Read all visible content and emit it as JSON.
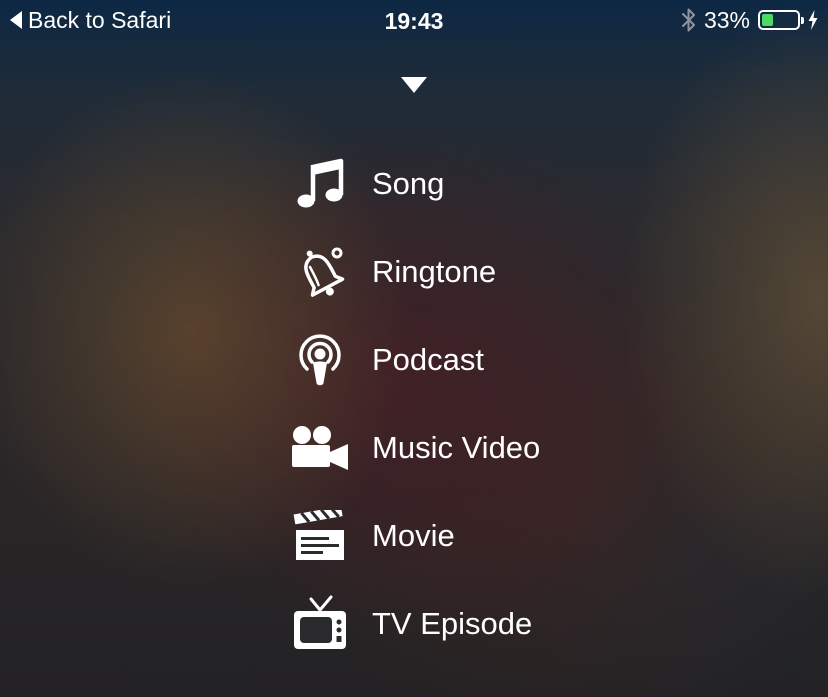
{
  "status_bar": {
    "back_label": "Back to Safari",
    "time": "19:43",
    "battery_percent": "33%",
    "battery_level": 0.33,
    "battery_color": "#4cd964",
    "icons": [
      "back-arrow-icon",
      "bluetooth-icon",
      "battery-icon",
      "charging-bolt-icon"
    ]
  },
  "sheet": {
    "dismiss_icon": "chevron-down-icon"
  },
  "menu": {
    "items": [
      {
        "label": "Song",
        "icon": "music-note-icon"
      },
      {
        "label": "Ringtone",
        "icon": "bell-icon"
      },
      {
        "label": "Podcast",
        "icon": "podcast-icon"
      },
      {
        "label": "Music Video",
        "icon": "video-camera-icon"
      },
      {
        "label": "Movie",
        "icon": "clapperboard-icon"
      },
      {
        "label": "TV Episode",
        "icon": "tv-icon"
      }
    ]
  }
}
